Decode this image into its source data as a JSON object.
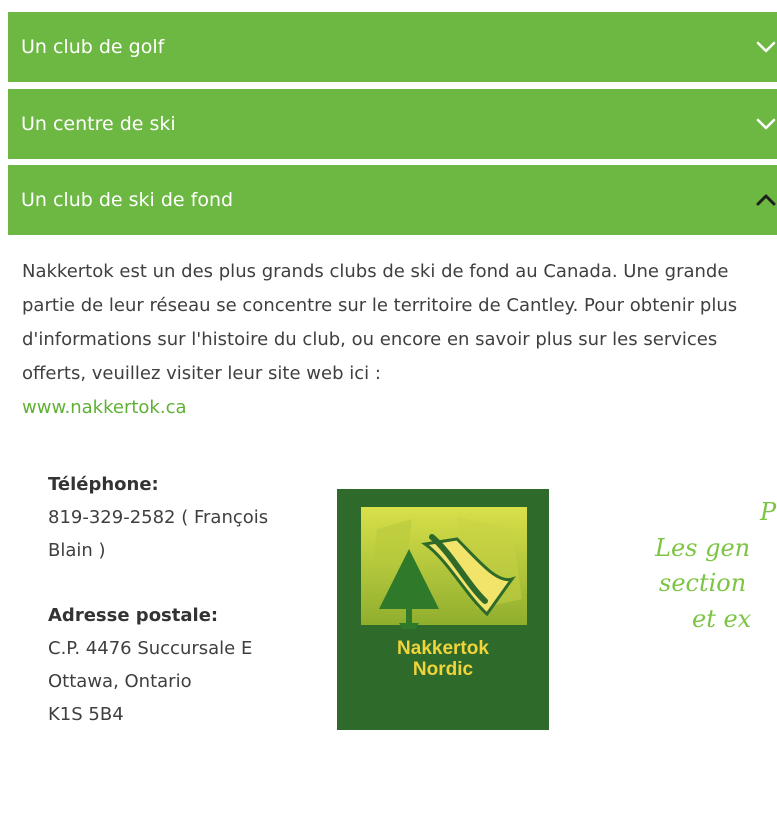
{
  "accordion": {
    "items": [
      {
        "label": "Un club de golf",
        "expanded": false
      },
      {
        "label": "Un centre de ski",
        "expanded": false
      },
      {
        "label": "Un club de ski de fond",
        "expanded": true
      }
    ]
  },
  "content": {
    "description": "Nakkertok est un des plus grands clubs de ski de fond au Canada. Une grande partie de leur réseau se concentre sur le territoire de Cantley. Pour obtenir plus d'informations sur l'histoire du club, ou encore en savoir plus sur les services offerts, veuillez visiter leur site web ici :",
    "link_text": "www.nakkertok.ca"
  },
  "contact": {
    "phone_label": "Téléphone:",
    "phone_value": "819-329-2582 ( François Blain )",
    "address_label": "Adresse postale:",
    "address_line1": "C.P. 4476 Succursale E",
    "address_line2": "Ottawa, Ontario",
    "address_line3": "K1S 5B4"
  },
  "logo": {
    "line1": "Nakkertok",
    "line2": "Nordic"
  },
  "handwritten_note": {
    "line1": "P",
    "line2": "Les gen",
    "line3": "section",
    "line4": "et ex"
  },
  "colors": {
    "accent_green": "#6cb843",
    "link_green": "#5fb034",
    "logo_bg": "#2e6b2b",
    "logo_text": "#f0d43a"
  },
  "icons": {
    "collapsed": "chevron-down-icon",
    "expanded": "chevron-up-icon"
  }
}
